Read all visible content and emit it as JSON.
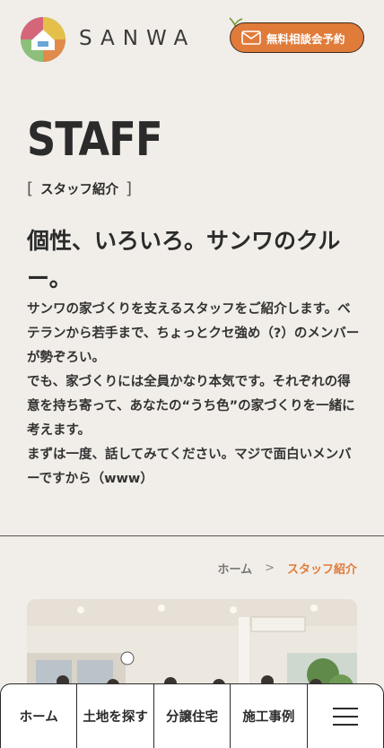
{
  "header": {
    "brand": "SANWA",
    "consult_button": "無料相談会予約"
  },
  "page": {
    "title": "STAFF",
    "subtitle": "スタッフ紹介",
    "lead": "個性、いろいろ。サンワのクルー。",
    "body": "サンワの家づくりを支えるスタッフをご紹介します。ベテランから若手まで、ちょっとクセ強め（?）のメンバーが勢ぞろい。\nでも、家づくりには全員かなり本気です。それぞれの得意を持ち寄って、あなたの“うち色”の家づくりを一緒に考えます。\nまずは一度、話してみてください。マジで面白いメンバーですから（www）"
  },
  "breadcrumb": {
    "home": "ホーム",
    "separator": ">",
    "current": "スタッフ紹介"
  },
  "bottom_nav": {
    "items": [
      "ホーム",
      "土地を探す",
      "分譲住宅",
      "施工事例"
    ],
    "menu_icon": "hamburger-menu-icon"
  },
  "colors": {
    "accent": "#e07b3a",
    "background": "#f1eee9",
    "text": "#2b2b2b"
  }
}
